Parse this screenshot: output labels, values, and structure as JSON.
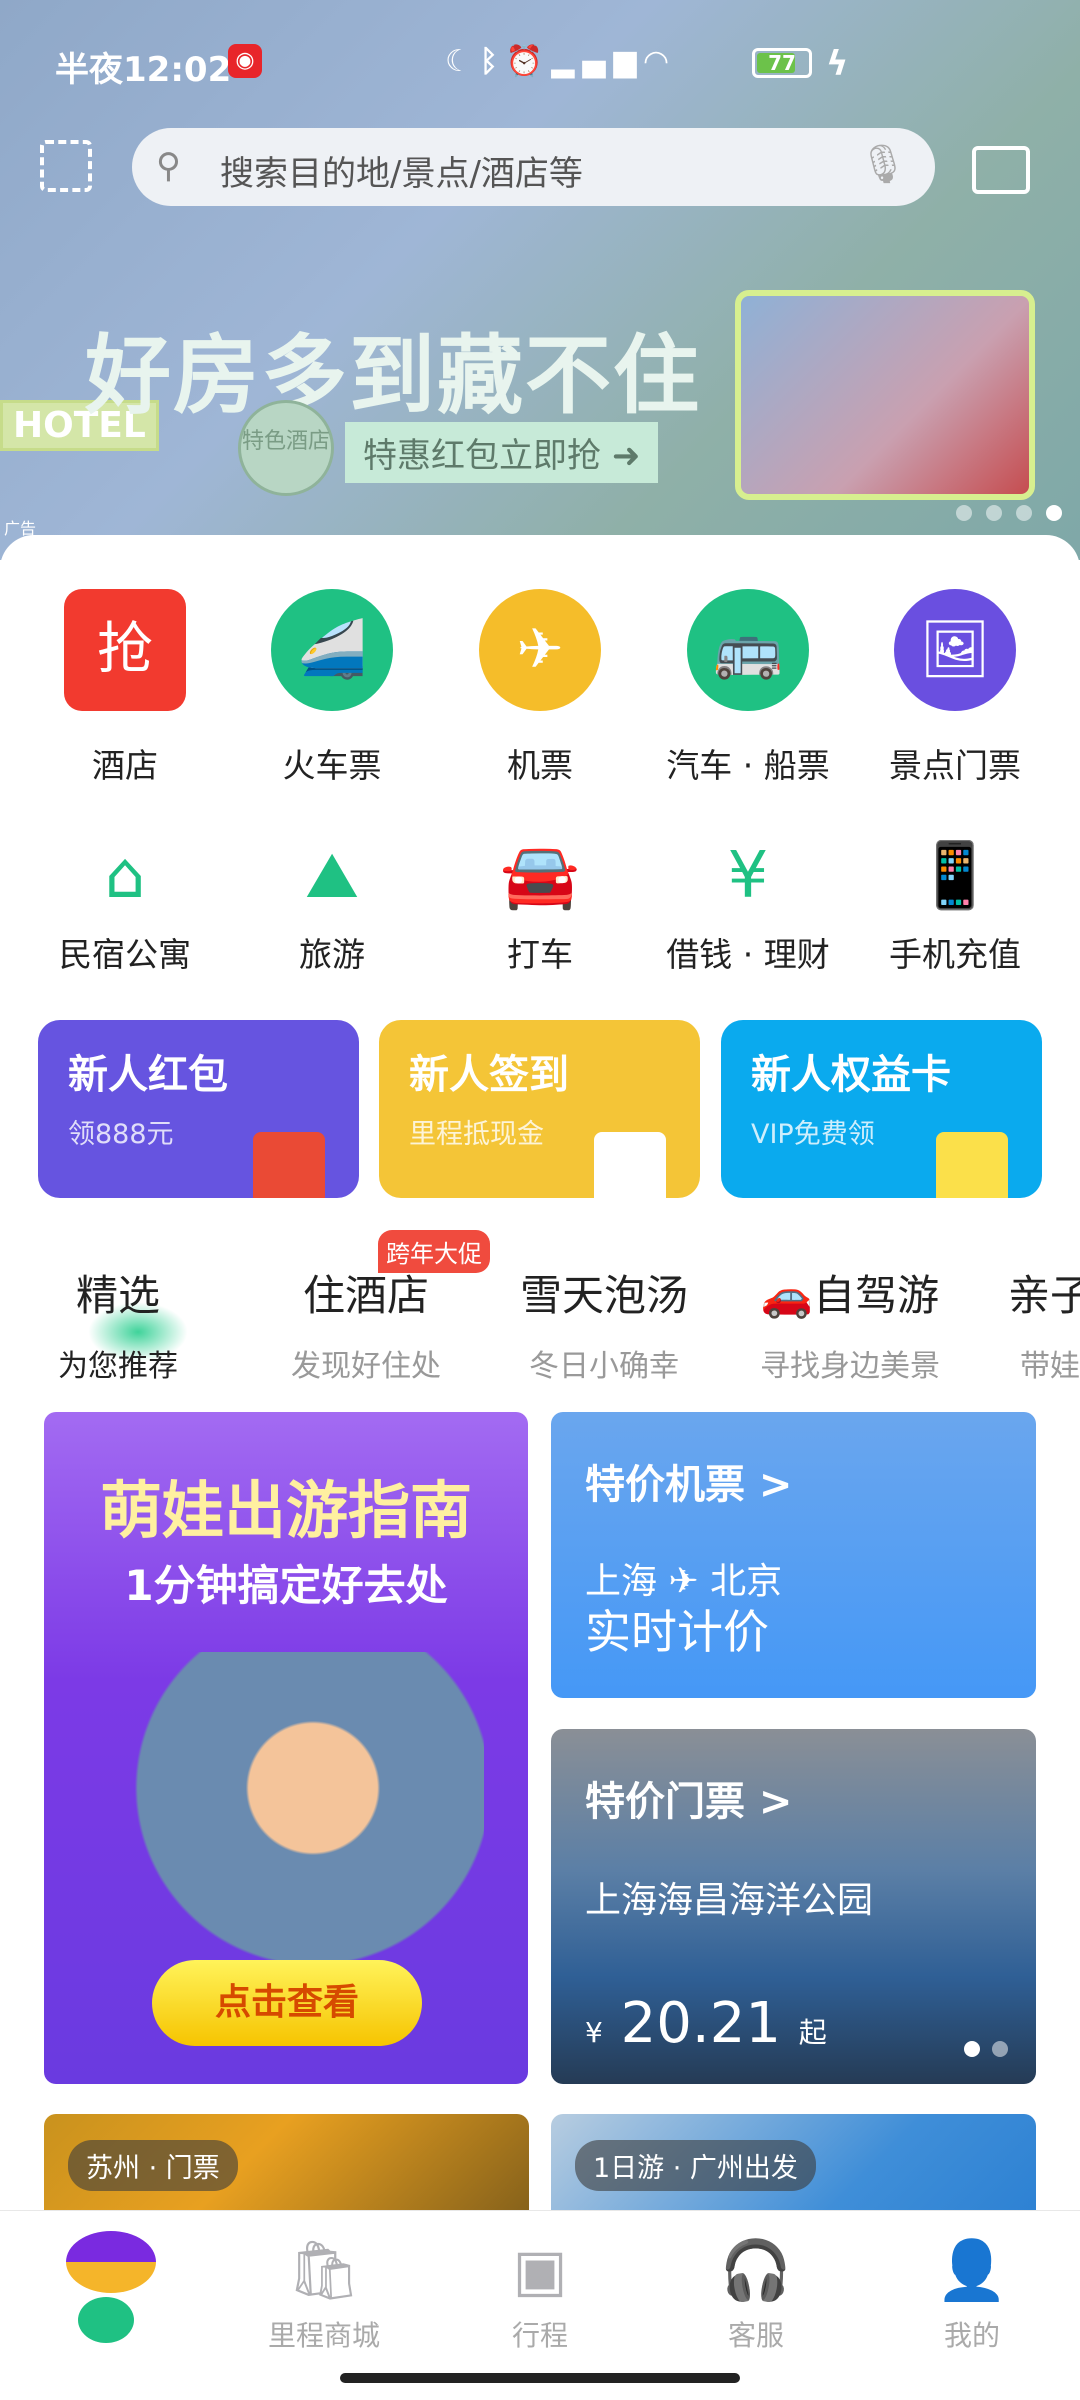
{
  "status_bar": {
    "time": "半夜12:02",
    "battery": "77",
    "icons": [
      "moon-icon",
      "bluetooth-icon",
      "alarm-icon",
      "signal-hd-icon",
      "signal-hd-icon",
      "wifi-icon",
      "battery-icon",
      "charging-icon"
    ]
  },
  "search": {
    "placeholder": "搜索目的地/景点/酒店等"
  },
  "banner": {
    "title": "好房多到藏不住",
    "subtitle": "特惠红包立即抢",
    "seal": "特色酒店",
    "hotel": "HOTEL",
    "ad_label": "广告",
    "page_count": 4,
    "active_page": 4
  },
  "services": [
    {
      "label": "酒店",
      "icon": "red-packet-icon",
      "color": "#f23a2f",
      "glyph": "抢"
    },
    {
      "label": "火车票",
      "icon": "train-icon",
      "color": "#1fc183",
      "glyph": "🚄"
    },
    {
      "label": "机票",
      "icon": "plane-icon",
      "color": "#f5bd2a",
      "glyph": "✈"
    },
    {
      "label": "汽车 · 船票",
      "icon": "bus-icon",
      "color": "#1fc183",
      "glyph": "🚌"
    },
    {
      "label": "景点门票",
      "icon": "ticket-icon",
      "color": "#6a4fe0",
      "glyph": "🖼"
    }
  ],
  "services2": [
    {
      "label": "民宿公寓",
      "icon": "house-icon",
      "glyph": "⌂"
    },
    {
      "label": "旅游",
      "icon": "mountain-icon",
      "glyph": "⛰"
    },
    {
      "label": "打车",
      "icon": "car-icon",
      "glyph": "🚘"
    },
    {
      "label": "借钱 · 理财",
      "icon": "money-bag-icon",
      "glyph": "¥"
    },
    {
      "label": "手机充值",
      "icon": "phone-icon",
      "glyph": "📱"
    }
  ],
  "promos": [
    {
      "title": "新人红包",
      "sub": "领888元",
      "color": "#6654e0"
    },
    {
      "title": "新人签到",
      "sub": "里程抵现金",
      "color": "#f4c537"
    },
    {
      "title": "新人权益卡",
      "sub": "VIP免费领",
      "color": "#0aaaee"
    }
  ],
  "tabs": [
    {
      "title": "精选",
      "sub": "为您推荐"
    },
    {
      "title": "住酒店",
      "sub": "发现好住处",
      "badge": "跨年大促"
    },
    {
      "title": "雪天泡汤",
      "sub": "冬日小确幸"
    },
    {
      "title": "🚗自驾游",
      "sub": "寻找身边美景"
    },
    {
      "title": "亲子",
      "sub": "带娃"
    }
  ],
  "feature": {
    "title": "萌娃出游指南",
    "subtitle": "1分钟搞定好去处",
    "button": "点击查看"
  },
  "flight_card": {
    "title": "特价机票 >",
    "from": "上海",
    "to": "北京",
    "note": "实时计价"
  },
  "ticket_card": {
    "title": "特价门票 >",
    "place": "上海海昌海洋公园",
    "currency": "¥",
    "price": "20.21",
    "suffix": "起"
  },
  "bottom_cards": [
    {
      "tag": "苏州 · 门票"
    },
    {
      "tag": "1日游 · 广州出发"
    }
  ],
  "nav": [
    {
      "label": "里程商城",
      "icon": "shopping-bag-icon"
    },
    {
      "label": "行程",
      "icon": "calendar-icon"
    },
    {
      "label": "客服",
      "icon": "headset-icon"
    },
    {
      "label": "我的",
      "icon": "user-icon"
    }
  ]
}
